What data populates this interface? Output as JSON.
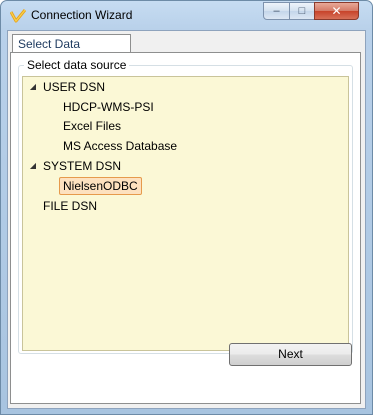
{
  "window": {
    "title": "Connection Wizard",
    "buttons": {
      "minimize": "–",
      "maximize": "□",
      "close": "✕"
    }
  },
  "tab": {
    "label": "Select Data Source..."
  },
  "group": {
    "label": "Select data source"
  },
  "tree": {
    "user_dsn": {
      "label": "USER DSN",
      "expander": "◢",
      "children": [
        "HDCP-WMS-PSI",
        "Excel Files",
        "MS Access Database"
      ]
    },
    "system_dsn": {
      "label": "SYSTEM DSN",
      "expander": "◢",
      "children": [
        "NielsenODBC"
      ]
    },
    "file_dsn": {
      "label": "FILE DSN"
    }
  },
  "footer": {
    "next_label": "Next"
  },
  "colors": {
    "tree_bg": "#fbf8d6",
    "selection_bg": "#fde1bf",
    "selection_border": "#e69a4c"
  }
}
